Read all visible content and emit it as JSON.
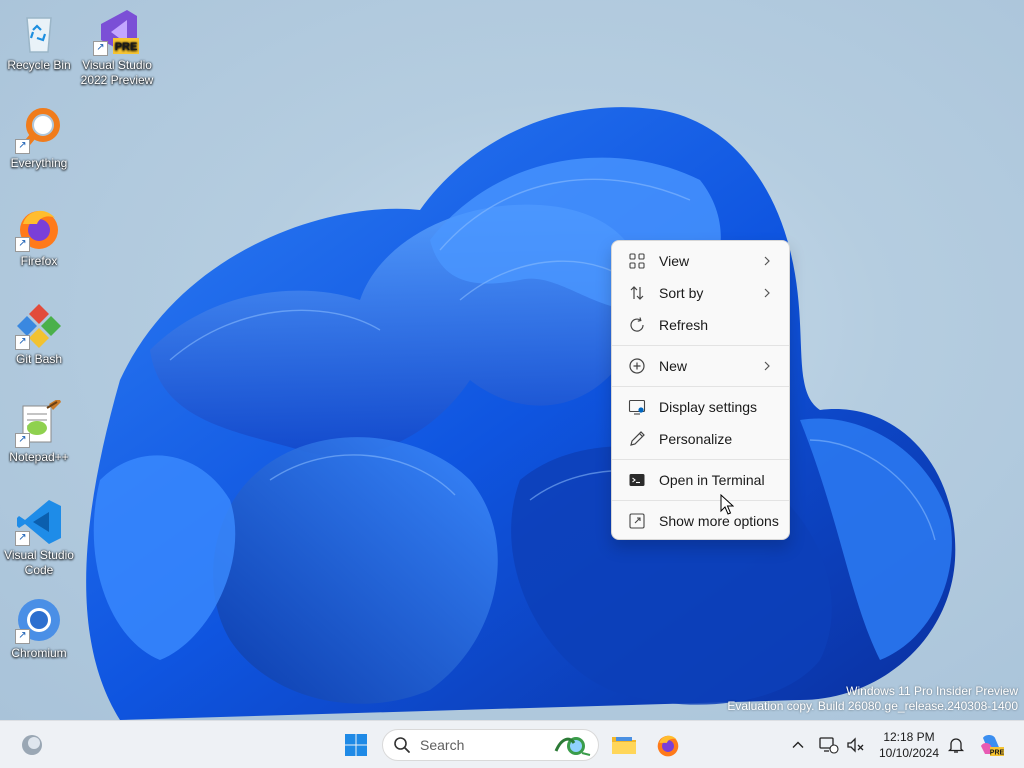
{
  "desktop_icons": [
    {
      "name": "recycle-bin",
      "label": "Recycle Bin"
    },
    {
      "name": "visual-studio-2022-preview",
      "label": "Visual Studio 2022 Preview",
      "badge": "PRE"
    },
    {
      "name": "everything",
      "label": "Everything"
    },
    {
      "name": "firefox",
      "label": "Firefox"
    },
    {
      "name": "git-bash",
      "label": "Git Bash"
    },
    {
      "name": "notepad-plus-plus",
      "label": "Notepad++"
    },
    {
      "name": "visual-studio-code",
      "label": "Visual Studio Code"
    },
    {
      "name": "chromium",
      "label": "Chromium"
    }
  ],
  "context_menu": {
    "items": [
      {
        "label": "View",
        "icon": "grid-icon",
        "submenu": true
      },
      {
        "label": "Sort by",
        "icon": "sort-icon",
        "submenu": true
      },
      {
        "label": "Refresh",
        "icon": "refresh-icon",
        "submenu": false
      },
      {
        "label": "New",
        "icon": "plus-circle-icon",
        "submenu": true
      },
      {
        "label": "Display settings",
        "icon": "display-settings-icon",
        "submenu": false
      },
      {
        "label": "Personalize",
        "icon": "pen-icon",
        "submenu": false
      },
      {
        "label": "Open in Terminal",
        "icon": "terminal-icon",
        "submenu": false
      },
      {
        "label": "Show more options",
        "icon": "expand-icon",
        "submenu": false
      }
    ]
  },
  "watermark": {
    "line1": "Windows 11 Pro Insider Preview",
    "line2": "Evaluation copy. Build 26080.ge_release.240308-1400"
  },
  "taskbar": {
    "search_placeholder": "Search",
    "time": "12:18 PM",
    "date": "10/10/2024",
    "copilot_badge": "PRE"
  },
  "colors": {
    "accent": "#0067c0",
    "menu_bg": "#f9f9f9",
    "taskbar_bg": "#eef1f5"
  }
}
